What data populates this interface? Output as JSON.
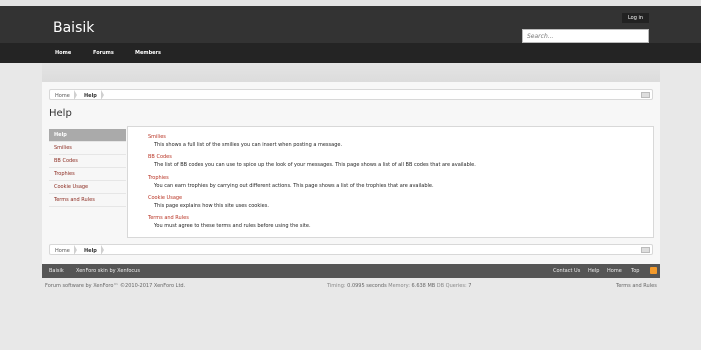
{
  "site": {
    "name": "Baisik"
  },
  "header": {
    "login_label": "Log in",
    "search_placeholder": "Search..."
  },
  "nav": {
    "tabs": [
      "Home",
      "Forums",
      "Members"
    ]
  },
  "breadcrumb": {
    "items": [
      "Home",
      "Help"
    ]
  },
  "page": {
    "title": "Help"
  },
  "sidebar": {
    "items": [
      "Help",
      "Smilies",
      "BB Codes",
      "Trophies",
      "Cookie Usage",
      "Terms and Rules"
    ]
  },
  "entries": [
    {
      "title": "Smilies",
      "desc": "This shows a full list of the smilies you can insert when posting a message."
    },
    {
      "title": "BB Codes",
      "desc": "The list of BB codes you can use to spice up the look of your messages. This page shows a list of all BB codes that are available."
    },
    {
      "title": "Trophies",
      "desc": "You can earn trophies by carrying out different actions. This page shows a list of the trophies that are available."
    },
    {
      "title": "Cookie Usage",
      "desc": "This page explains how this site uses cookies."
    },
    {
      "title": "Terms and Rules",
      "desc": "You must agree to these terms and rules before using the site."
    }
  ],
  "footer": {
    "site_link": "Baisik",
    "skin": "XenForo skin by Xenfocus",
    "links": [
      "Contact Us",
      "Help",
      "Home",
      "Top"
    ]
  },
  "legal": {
    "copyright": "Forum software by XenForo™ ©2010-2017 XenForo Ltd.",
    "timing_label": "Timing:",
    "timing_value": "0.0995 seconds",
    "memory_label": "Memory:",
    "memory_value": "6.638 MB",
    "db_label": "DB Queries:",
    "db_value": "7",
    "terms": "Terms and Rules"
  },
  "colors": {
    "link": "#b83222",
    "header": "#333333",
    "navbar": "#242424",
    "footer": "#555555",
    "rss": "#f39a2b"
  },
  "icons": {
    "rss": "rss-icon",
    "jump": "jump-menu-icon"
  }
}
